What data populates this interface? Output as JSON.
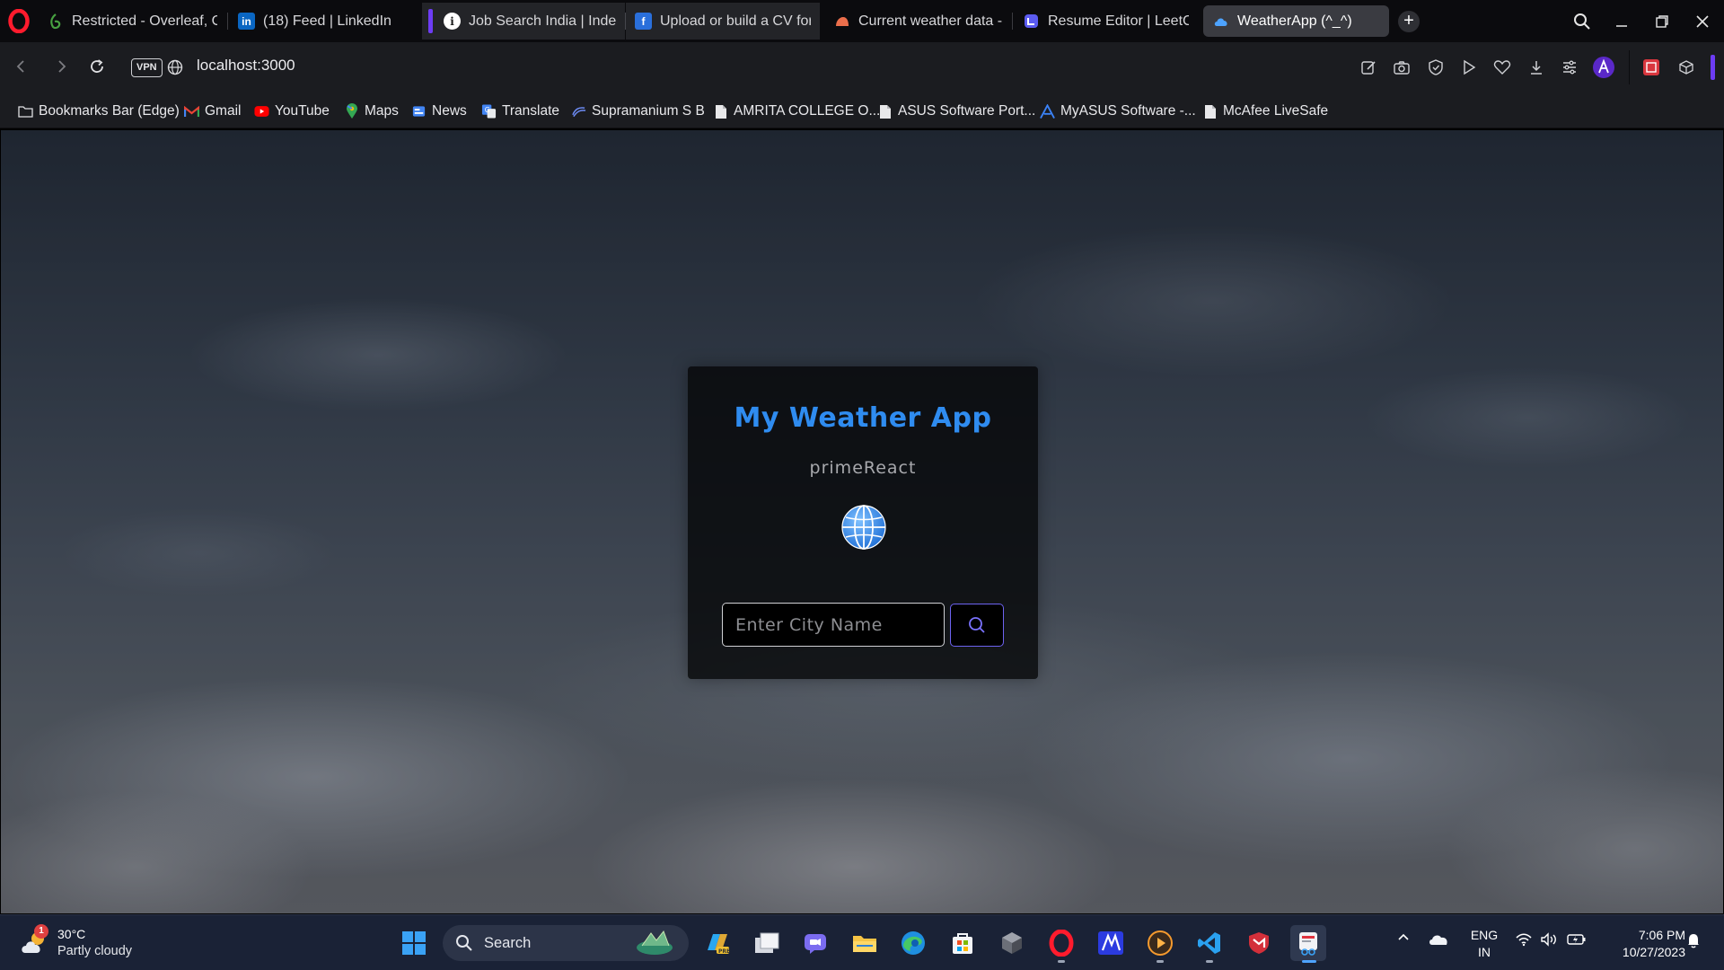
{
  "browser": {
    "tabs": [
      {
        "label": "Restricted - Overleaf, Onli",
        "icon": "overleaf-icon"
      },
      {
        "label": "(18) Feed | LinkedIn",
        "icon": "linkedin-icon"
      },
      {
        "label": "Job Search India | Indeed",
        "icon": "indeed-icon"
      },
      {
        "label": "Upload or build a CV for t",
        "icon": "cv-site-icon"
      },
      {
        "label": "Current weather data - O",
        "icon": "openweather-icon"
      },
      {
        "label": "Resume Editor | LeetCV",
        "icon": "leetcv-icon"
      },
      {
        "label": "WeatherApp (^_^)",
        "icon": "cloud-icon"
      }
    ],
    "new_tab": "+",
    "vpn": "VPN",
    "url": "localhost:3000",
    "bookmarks": [
      {
        "label": "Bookmarks Bar (Edge)",
        "icon": "folder-icon"
      },
      {
        "label": "Gmail",
        "icon": "gmail-icon"
      },
      {
        "label": "YouTube",
        "icon": "youtube-icon"
      },
      {
        "label": "Maps",
        "icon": "maps-icon"
      },
      {
        "label": "News",
        "icon": "news-icon"
      },
      {
        "label": "Translate",
        "icon": "translate-icon"
      },
      {
        "label": "Supramanium S B",
        "icon": "link-icon"
      },
      {
        "label": "AMRITA COLLEGE O...",
        "icon": "page-icon"
      },
      {
        "label": "ASUS Software Port...",
        "icon": "page-icon"
      },
      {
        "label": "MyASUS Software -...",
        "icon": "myasus-icon"
      },
      {
        "label": "McAfee LiveSafe",
        "icon": "page-icon"
      }
    ]
  },
  "app": {
    "title": "My Weather App",
    "subtitle": "primeReact",
    "city_placeholder": "Enter City Name",
    "city_value": "",
    "accent": "#2f8cf0",
    "button_border": "#6d63f0"
  },
  "taskbar": {
    "weather": {
      "badge": "1",
      "temp": "30°C",
      "condition": "Partly cloudy"
    },
    "search_label": "Search",
    "language": {
      "line1": "ENG",
      "line2": "IN"
    },
    "clock": {
      "time": "7:06 PM",
      "date": "10/27/2023"
    }
  }
}
